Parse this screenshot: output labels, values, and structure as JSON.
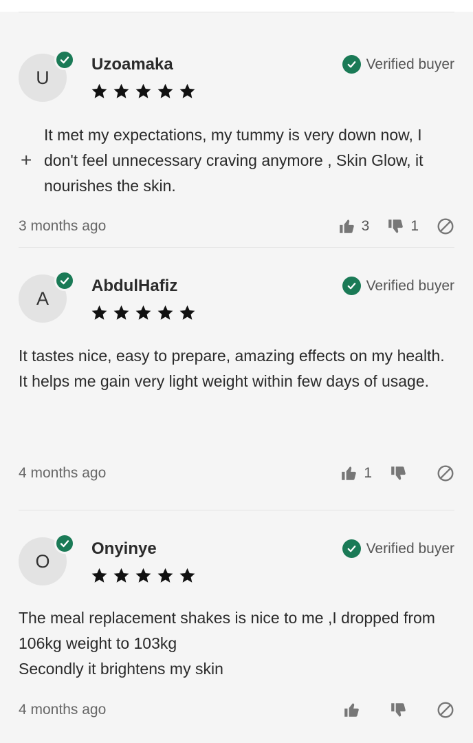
{
  "colors": {
    "verified_green": "#1a7a56",
    "background": "#f5f5f5",
    "icon_gray": "#777777"
  },
  "icons": {
    "avatar_badge": "check-circle-icon",
    "verified": "check-circle-icon",
    "rating": "star-icon",
    "like": "thumbs-up-icon",
    "dislike": "thumbs-down-icon",
    "report": "block-icon",
    "expand": "plus-icon"
  },
  "reviews": [
    {
      "initial": "U",
      "name": "Uzoamaka",
      "rating": 5,
      "verified_label": "Verified buyer",
      "expand_symbol": "+",
      "text_lines": [
        "It met my expectations, my tummy is very down now, I don't feel unnecessary craving anymore , Skin Glow, it nourishes the skin."
      ],
      "date": "3 months ago",
      "likes": "3",
      "dislikes": "1"
    },
    {
      "initial": "A",
      "name": "AbdulHafiz",
      "rating": 5,
      "verified_label": "Verified buyer",
      "text_lines": [
        "It tastes nice, easy to prepare, amazing effects on my health.",
        "It helps me gain very light weight within few days of usage."
      ],
      "date": "4 months ago",
      "likes": "1",
      "dislikes": ""
    },
    {
      "initial": "O",
      "name": "Onyinye",
      "rating": 5,
      "verified_label": "Verified buyer",
      "text_lines": [
        "The meal replacement shakes is nice to me ,I dropped from 106kg weight to 103kg",
        "Secondly it brightens my skin"
      ],
      "date": "4 months ago",
      "likes": "",
      "dislikes": ""
    }
  ]
}
